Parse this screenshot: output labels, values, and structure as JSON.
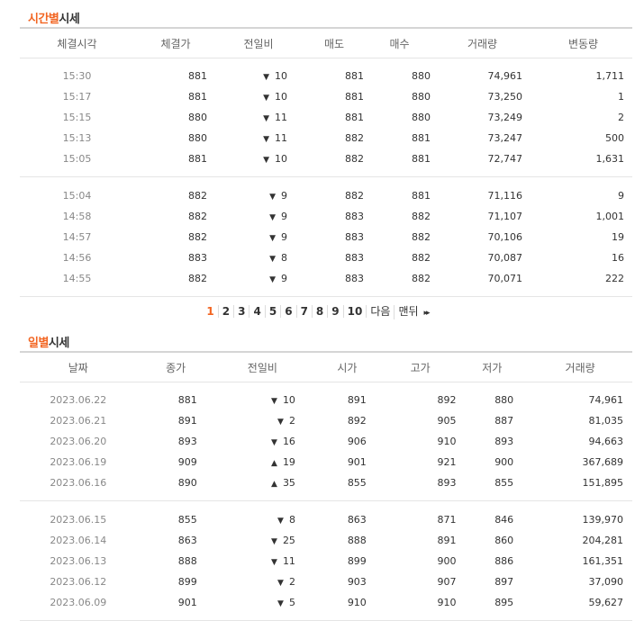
{
  "time_section": {
    "title_accent": "시간별",
    "title_rest": "시세",
    "headers": [
      "체결시각",
      "체결가",
      "전일비",
      "매도",
      "매수",
      "거래량",
      "변동량"
    ],
    "groups": [
      [
        {
          "time": "15:30",
          "price": "881",
          "dir": "down",
          "diff": "10",
          "ask": "881",
          "bid": "880",
          "volume": "74,961",
          "change": "1,711"
        },
        {
          "time": "15:17",
          "price": "881",
          "dir": "down",
          "diff": "10",
          "ask": "881",
          "bid": "880",
          "volume": "73,250",
          "change": "1"
        },
        {
          "time": "15:15",
          "price": "880",
          "dir": "down",
          "diff": "11",
          "ask": "881",
          "bid": "880",
          "volume": "73,249",
          "change": "2"
        },
        {
          "time": "15:13",
          "price": "880",
          "dir": "down",
          "diff": "11",
          "ask": "882",
          "bid": "881",
          "volume": "73,247",
          "change": "500"
        },
        {
          "time": "15:05",
          "price": "881",
          "dir": "down",
          "diff": "10",
          "ask": "882",
          "bid": "881",
          "volume": "72,747",
          "change": "1,631"
        }
      ],
      [
        {
          "time": "15:04",
          "price": "882",
          "dir": "down",
          "diff": "9",
          "ask": "882",
          "bid": "881",
          "volume": "71,116",
          "change": "9"
        },
        {
          "time": "14:58",
          "price": "882",
          "dir": "down",
          "diff": "9",
          "ask": "883",
          "bid": "882",
          "volume": "71,107",
          "change": "1,001"
        },
        {
          "time": "14:57",
          "price": "882",
          "dir": "down",
          "diff": "9",
          "ask": "883",
          "bid": "882",
          "volume": "70,106",
          "change": "19"
        },
        {
          "time": "14:56",
          "price": "883",
          "dir": "down",
          "diff": "8",
          "ask": "883",
          "bid": "882",
          "volume": "70,087",
          "change": "16"
        },
        {
          "time": "14:55",
          "price": "882",
          "dir": "down",
          "diff": "9",
          "ask": "883",
          "bid": "882",
          "volume": "70,071",
          "change": "222"
        }
      ]
    ]
  },
  "pagination": {
    "pages": [
      "1",
      "2",
      "3",
      "4",
      "5",
      "6",
      "7",
      "8",
      "9",
      "10"
    ],
    "current": "1",
    "next_label": "다음",
    "last_label": "맨뒤",
    "last_arrow": "▸▸"
  },
  "daily_section": {
    "title_accent": "일별",
    "title_rest": "시세",
    "headers": [
      "날짜",
      "종가",
      "전일비",
      "시가",
      "고가",
      "저가",
      "거래량"
    ],
    "groups": [
      [
        {
          "date": "2023.06.22",
          "close": "881",
          "dir": "down",
          "diff": "10",
          "open": "891",
          "high": "892",
          "low": "880",
          "volume": "74,961"
        },
        {
          "date": "2023.06.21",
          "close": "891",
          "dir": "down",
          "diff": "2",
          "open": "892",
          "high": "905",
          "low": "887",
          "volume": "81,035"
        },
        {
          "date": "2023.06.20",
          "close": "893",
          "dir": "down",
          "diff": "16",
          "open": "906",
          "high": "910",
          "low": "893",
          "volume": "94,663"
        },
        {
          "date": "2023.06.19",
          "close": "909",
          "dir": "up",
          "diff": "19",
          "open": "901",
          "high": "921",
          "low": "900",
          "volume": "367,689"
        },
        {
          "date": "2023.06.16",
          "close": "890",
          "dir": "up",
          "diff": "35",
          "open": "855",
          "high": "893",
          "low": "855",
          "volume": "151,895"
        }
      ],
      [
        {
          "date": "2023.06.15",
          "close": "855",
          "dir": "down",
          "diff": "8",
          "open": "863",
          "high": "871",
          "low": "846",
          "volume": "139,970"
        },
        {
          "date": "2023.06.14",
          "close": "863",
          "dir": "down",
          "diff": "25",
          "open": "888",
          "high": "891",
          "low": "860",
          "volume": "204,281"
        },
        {
          "date": "2023.06.13",
          "close": "888",
          "dir": "down",
          "diff": "11",
          "open": "899",
          "high": "900",
          "low": "886",
          "volume": "161,351"
        },
        {
          "date": "2023.06.12",
          "close": "899",
          "dir": "down",
          "diff": "2",
          "open": "903",
          "high": "907",
          "low": "897",
          "volume": "37,090"
        },
        {
          "date": "2023.06.09",
          "close": "901",
          "dir": "down",
          "diff": "5",
          "open": "910",
          "high": "910",
          "low": "895",
          "volume": "59,627"
        }
      ]
    ]
  },
  "colors": {
    "accent": "#f26522",
    "down": "#1a5cc8",
    "up": "#d11e1e"
  },
  "icons": {
    "down": "▼",
    "up": "▲"
  }
}
